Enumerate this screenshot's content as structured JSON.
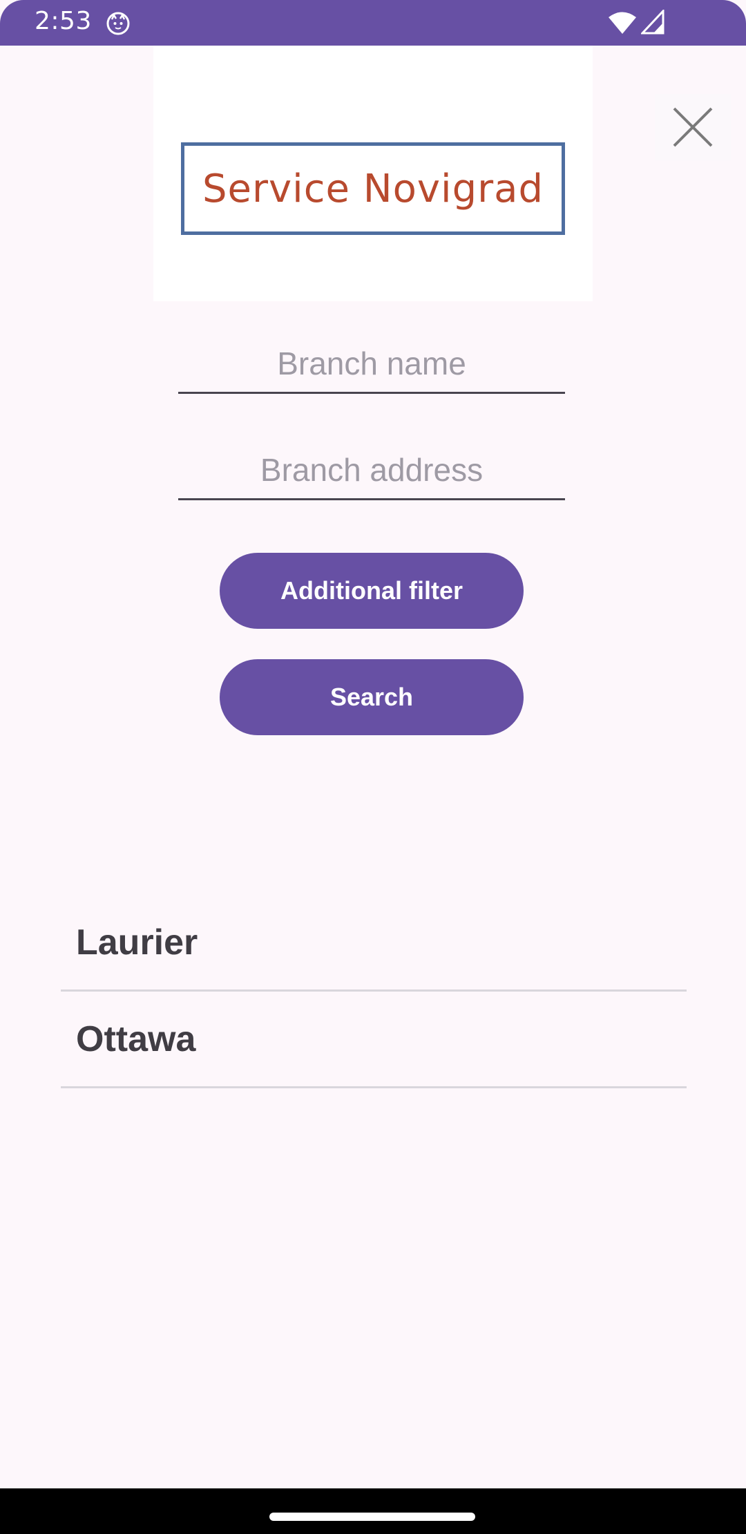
{
  "status_bar": {
    "time": "2:53",
    "icons": [
      "cat-notification-icon",
      "wifi-icon",
      "cellular-signal-icon"
    ]
  },
  "logo": {
    "text": "Service Novigrad",
    "text_color": "#b84a2e",
    "frame_color": "#4e6ea0"
  },
  "close_button": {
    "icon": "close-icon"
  },
  "form": {
    "branch_name": {
      "value": "",
      "placeholder": "Branch name"
    },
    "branch_address": {
      "value": "",
      "placeholder": "Branch address"
    }
  },
  "buttons": {
    "additional_filter": "Additional filter",
    "search": "Search"
  },
  "branches": [
    {
      "name": "Laurier"
    },
    {
      "name": "Ottawa"
    }
  ],
  "colors": {
    "primary": "#6750a4",
    "background": "#fdf7fb",
    "list_text": "#403d44",
    "divider": "#d9d6dc"
  }
}
